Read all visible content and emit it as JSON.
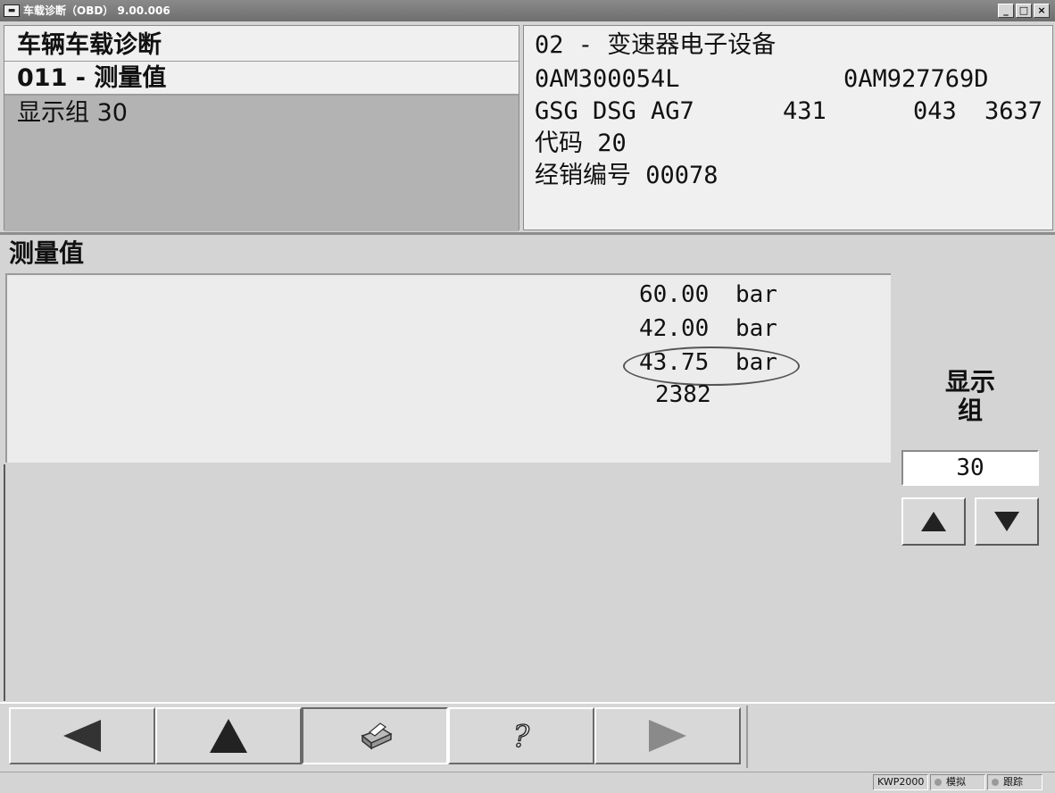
{
  "window": {
    "title": "车载诊断（OBD） 9.00.006",
    "icon": "car-icon",
    "controls": [
      "_",
      "□",
      "×"
    ]
  },
  "left_panel": {
    "line1": "车辆车载诊断",
    "line2": "011 - 测量值",
    "line3": "显示组 30"
  },
  "right_panel": {
    "module": "02 - 变速器电子设备",
    "part_number": "0AM300054L",
    "part_number_2": "0AM927769D",
    "component": "GSG DSG AG7",
    "comp_val1": "431",
    "comp_val2": "043",
    "comp_val3": "3637",
    "code": "代码 20",
    "dealer": "经销编号 00078"
  },
  "section": {
    "title": "测量值"
  },
  "values": [
    {
      "num": "60.00",
      "unit": "bar"
    },
    {
      "num": "42.00",
      "unit": "bar"
    },
    {
      "num": "43.75",
      "unit": "bar"
    },
    {
      "num": "2382",
      "unit": ""
    }
  ],
  "display_group": {
    "label_line1": "显示",
    "label_line2": "组",
    "value": "30"
  },
  "nav_buttons": [
    {
      "name": "back-button",
      "icon": "arrow-left-icon"
    },
    {
      "name": "up-button",
      "icon": "arrow-up-icon"
    },
    {
      "name": "print-button",
      "icon": "printer-icon"
    },
    {
      "name": "help-button",
      "icon": "question-icon"
    },
    {
      "name": "forward-button",
      "icon": "arrow-right-icon"
    }
  ],
  "status": {
    "protocol": "KWP2000",
    "sim": "模拟",
    "trace": "跟踪"
  },
  "colors": {
    "titlebar": "#7a7a7a",
    "selected_row": "#b3b3b3",
    "panel_bg": "#f0f0f0"
  }
}
